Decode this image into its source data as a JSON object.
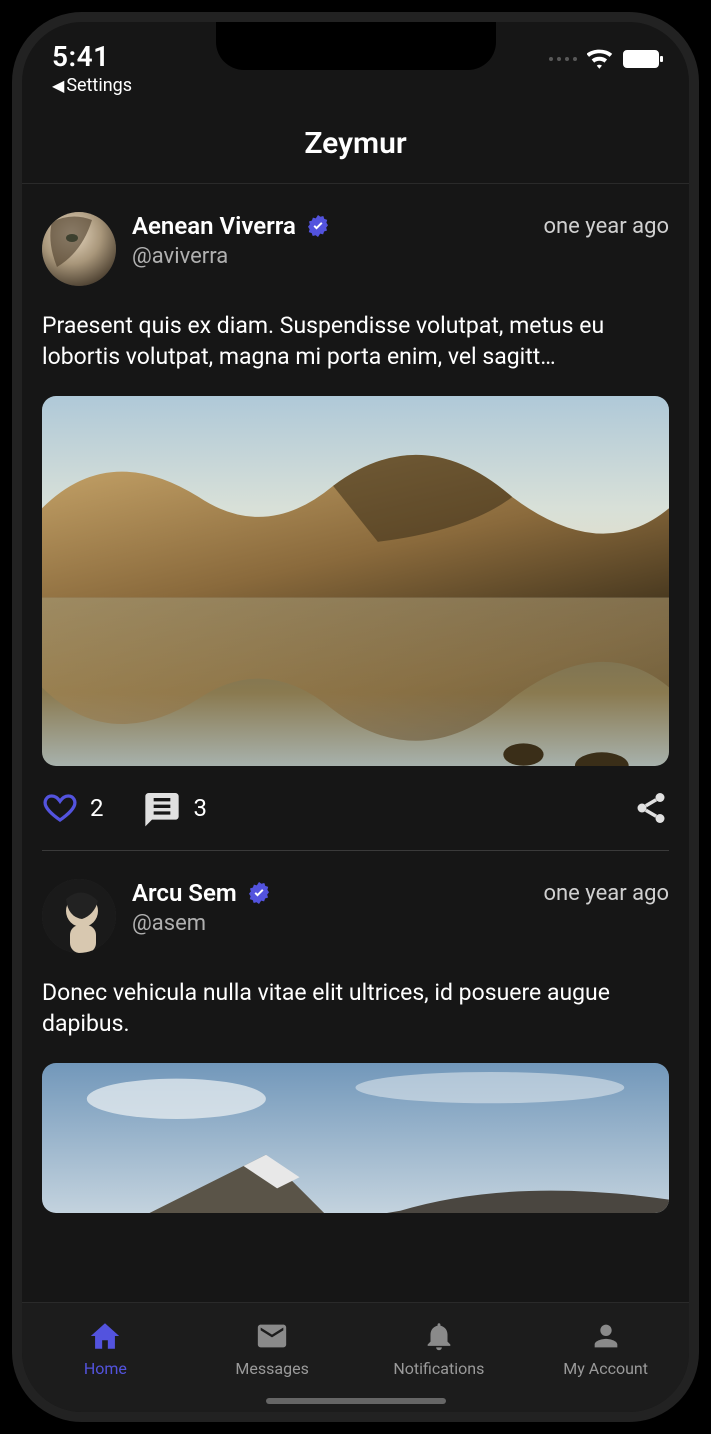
{
  "statusbar": {
    "time": "5:41",
    "back_label": "Settings"
  },
  "header": {
    "title": "Zeymur"
  },
  "colors": {
    "accent": "#5353de",
    "text_muted": "#9a9a9a"
  },
  "posts": [
    {
      "display_name": "Aenean Viverra",
      "handle": "@aviverra",
      "verified": true,
      "timestamp": "one year ago",
      "body": "Praesent quis ex diam. Suspendisse volutpat, metus eu lobortis volutpat, magna mi porta enim, vel sagitt…",
      "likes": "2",
      "comments": "3",
      "image_alt": "lake-mountains-landscape"
    },
    {
      "display_name": "Arcu Sem",
      "handle": "@asem",
      "verified": true,
      "timestamp": "one year ago",
      "body": "Donec vehicula nulla vitae elit ultrices, id posuere augue dapibus.",
      "image_alt": "snowy-mountain-sky"
    }
  ],
  "tabs": [
    {
      "label": "Home",
      "icon": "home-icon",
      "active": true
    },
    {
      "label": "Messages",
      "icon": "mail-icon",
      "active": false
    },
    {
      "label": "Notifications",
      "icon": "bell-icon",
      "active": false
    },
    {
      "label": "My Account",
      "icon": "person-icon",
      "active": false
    }
  ]
}
